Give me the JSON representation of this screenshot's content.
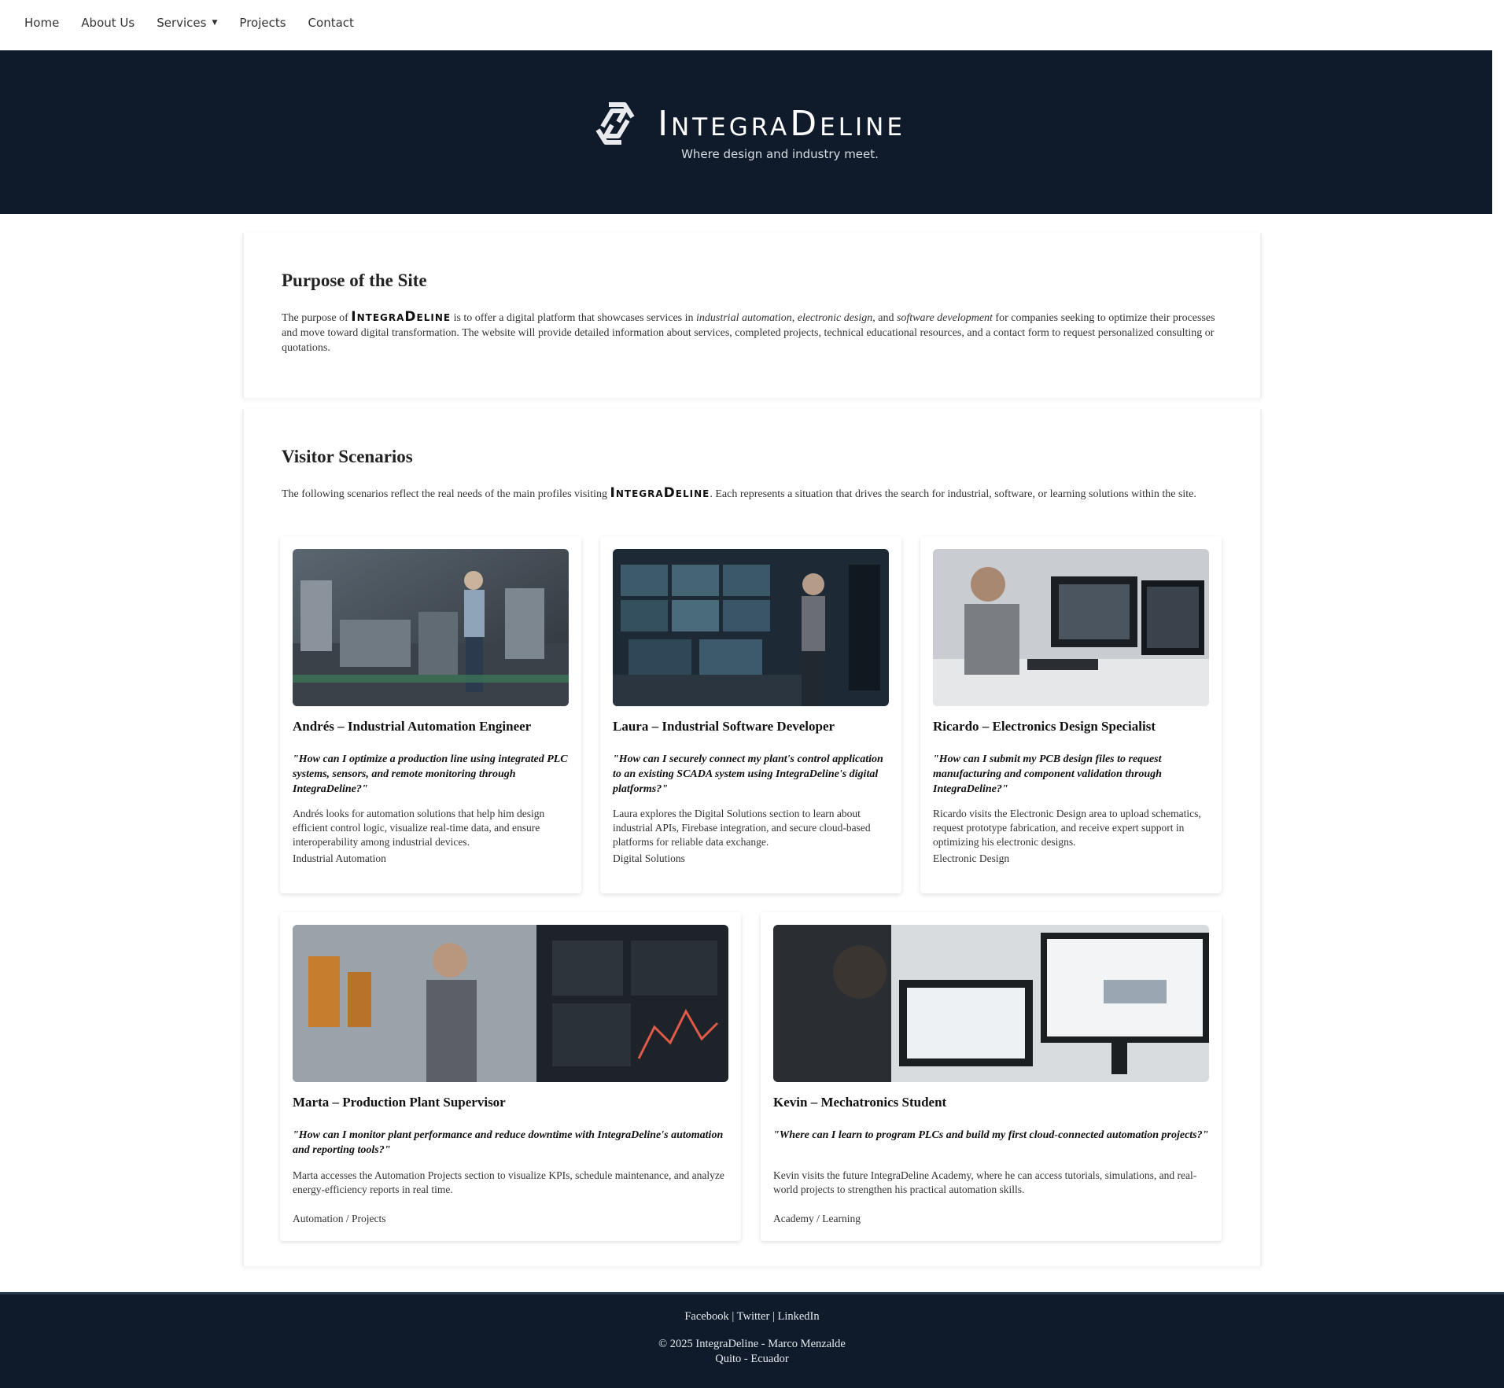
{
  "nav": {
    "items": [
      "Home",
      "About Us",
      "Services",
      "Projects",
      "Contact"
    ],
    "caret": "▼"
  },
  "hero": {
    "brand": "IntegraDeline",
    "tagline": "Where design and industry meet."
  },
  "purpose": {
    "title": "Purpose of the Site",
    "text_before": "The purpose of ",
    "brand": "IntegraDeline",
    "text_middle": " is to offer a digital platform that showcases services in ",
    "em1": "industrial automation",
    "sep1": ", ",
    "em2": "electronic design",
    "sep2": ", and ",
    "em3": "software development",
    "text_after": " for companies seeking to optimize their processes and move toward digital transformation. The website will provide detailed information about services, completed projects, technical educational resources, and a contact form to request personalized consulting or quotations."
  },
  "visitors": {
    "title": "Visitor Scenarios",
    "text_before": "The following scenarios reflect the real needs of the main profiles visiting ",
    "brand": "IntegraDeline",
    "text_after": ". Each represents a situation that drives the search for industrial, software, or learning solutions within the site.",
    "cards": [
      {
        "name": "Andrés – Industrial Automation Engineer",
        "quote": "\"How can I optimize a production line using integrated PLC systems, sensors, and remote monitoring through IntegraDeline?\"",
        "desc": "Andrés looks for automation solutions that help him design efficient control logic, visualize real-time data, and ensure interoperability among industrial devices.",
        "tag": "Industrial Automation"
      },
      {
        "name": "Laura – Industrial Software Developer",
        "quote": "\"How can I securely connect my plant's control application to an existing SCADA system using IntegraDeline's digital platforms?\"",
        "desc": "Laura explores the Digital Solutions section to learn about industrial APIs, Firebase integration, and secure cloud-based platforms for reliable data exchange.",
        "tag": "Digital Solutions"
      },
      {
        "name": "Ricardo – Electronics Design Specialist",
        "quote": "\"How can I submit my PCB design files to request manufacturing and component validation through IntegraDeline?\"",
        "desc": "Ricardo visits the Electronic Design area to upload schematics, request prototype fabrication, and receive expert support in optimizing his electronic designs.",
        "tag": "Electronic Design"
      },
      {
        "name": "Marta – Production Plant Supervisor",
        "quote": "\"How can I monitor plant performance and reduce downtime with IntegraDeline's automation and reporting tools?\"",
        "desc": "Marta accesses the Automation Projects section to visualize KPIs, schedule maintenance, and analyze energy-efficiency reports in real time.",
        "tag": "Automation / Projects"
      },
      {
        "name": "Kevin – Mechatronics Student",
        "quote": "\"Where can I learn to program PLCs and build my first cloud-connected automation projects?\"",
        "desc": "Kevin visits the future IntegraDeline Academy, where he can access tutorials, simulations, and real-world projects to strengthen his practical automation skills.",
        "tag": "Academy / Learning"
      }
    ]
  },
  "footer": {
    "links": [
      "Facebook",
      "Twitter",
      "LinkedIn"
    ],
    "separator": " | ",
    "copyright": "© 2025 IntegraDeline - Marco Menzalde",
    "location": "Quito - Ecuador"
  },
  "colors": {
    "hero_bg": "#0f1b2a",
    "footer_bg": "#0f1b2a",
    "text": "#222222"
  }
}
